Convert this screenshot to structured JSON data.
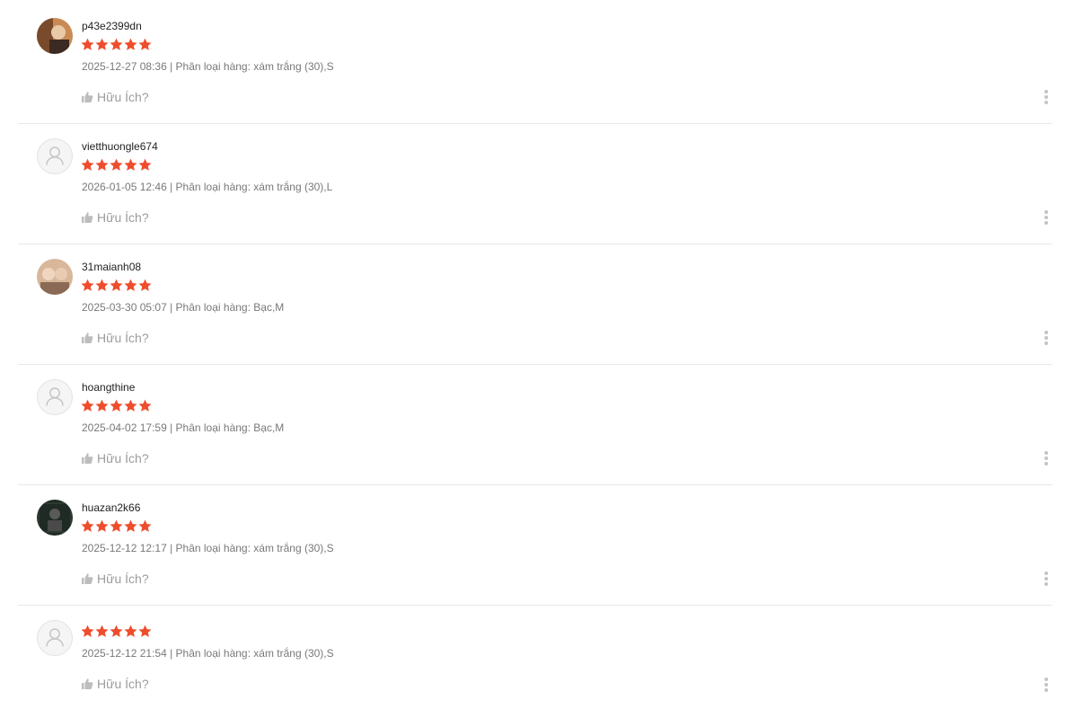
{
  "theme": {
    "star_color": "#ee4d2d",
    "divider_color": "#e8e8e8"
  },
  "helpful_label": "Hữu Ích?",
  "reviews": [
    {
      "username": "p43e2399dn",
      "rating": 5,
      "meta": "2025-12-27 08:36 | Phân loại hàng: xám trắng (30),S",
      "avatar": "photo"
    },
    {
      "username": "vietthuongle674",
      "rating": 5,
      "meta": "2026-01-05 12:46 | Phân loại hàng: xám trắng (30),L",
      "avatar": "default-user-icon"
    },
    {
      "username": "31maianh08",
      "rating": 5,
      "meta": "2025-03-30 05:07 | Phân loại hàng: Bạc,M",
      "avatar": "photo"
    },
    {
      "username": "hoangthine",
      "rating": 5,
      "meta": "2025-04-02 17:59 | Phân loại hàng: Bạc,M",
      "avatar": "default-user-icon"
    },
    {
      "username": "huazan2k66",
      "rating": 5,
      "meta": "2025-12-12 12:17 | Phân loại hàng: xám trắng (30),S",
      "avatar": "photo"
    },
    {
      "username": "",
      "rating": 5,
      "meta": "2025-12-12 21:54 | Phân loại hàng: xám trắng (30),S",
      "avatar": "default-user-icon"
    }
  ]
}
